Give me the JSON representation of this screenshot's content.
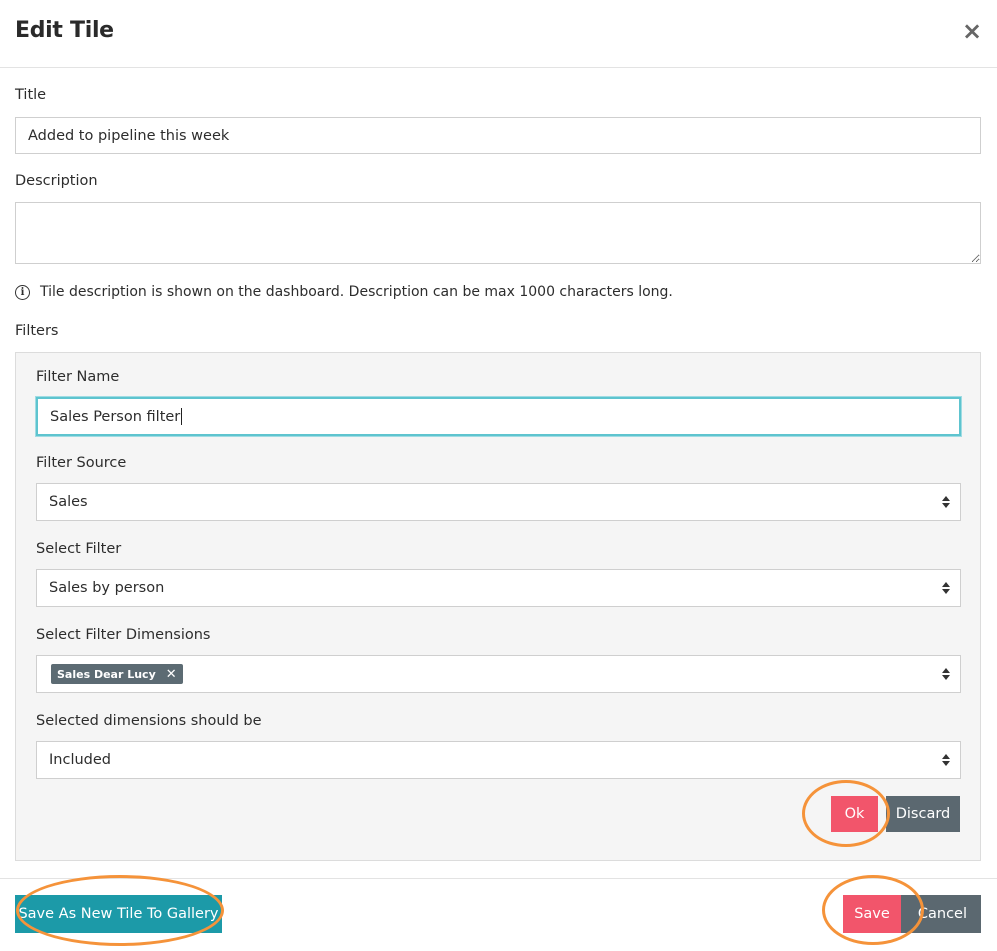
{
  "header": {
    "title": "Edit Tile",
    "close_symbol": "×"
  },
  "form": {
    "title_label": "Title",
    "title_value": "Added to pipeline this week",
    "description_label": "Description",
    "description_value": "",
    "help_text": "Tile description is shown on the dashboard. Description can be max 1000 characters long.",
    "filters_label": "Filters"
  },
  "filter_editor": {
    "name_label": "Filter Name",
    "name_value": "Sales Person filter",
    "source_label": "Filter Source",
    "source_value": "Sales",
    "select_filter_label": "Select Filter",
    "select_filter_value": "Sales by person",
    "dimensions_label": "Select Filter Dimensions",
    "dimension_tags": [
      "Sales Dear Lucy"
    ],
    "selected_should_be_label": "Selected dimensions should be",
    "selected_should_be_value": "Included",
    "ok_label": "Ok",
    "discard_label": "Discard"
  },
  "footer": {
    "save_gallery_label": "Save As New Tile To Gallery",
    "save_label": "Save",
    "cancel_label": "Cancel"
  },
  "colors": {
    "primary_red": "#f2556b",
    "dark_gray": "#5b6870",
    "teal": "#1c9aa8",
    "highlight_ring": "#f5933a",
    "focus_border": "#5ec4cf"
  }
}
